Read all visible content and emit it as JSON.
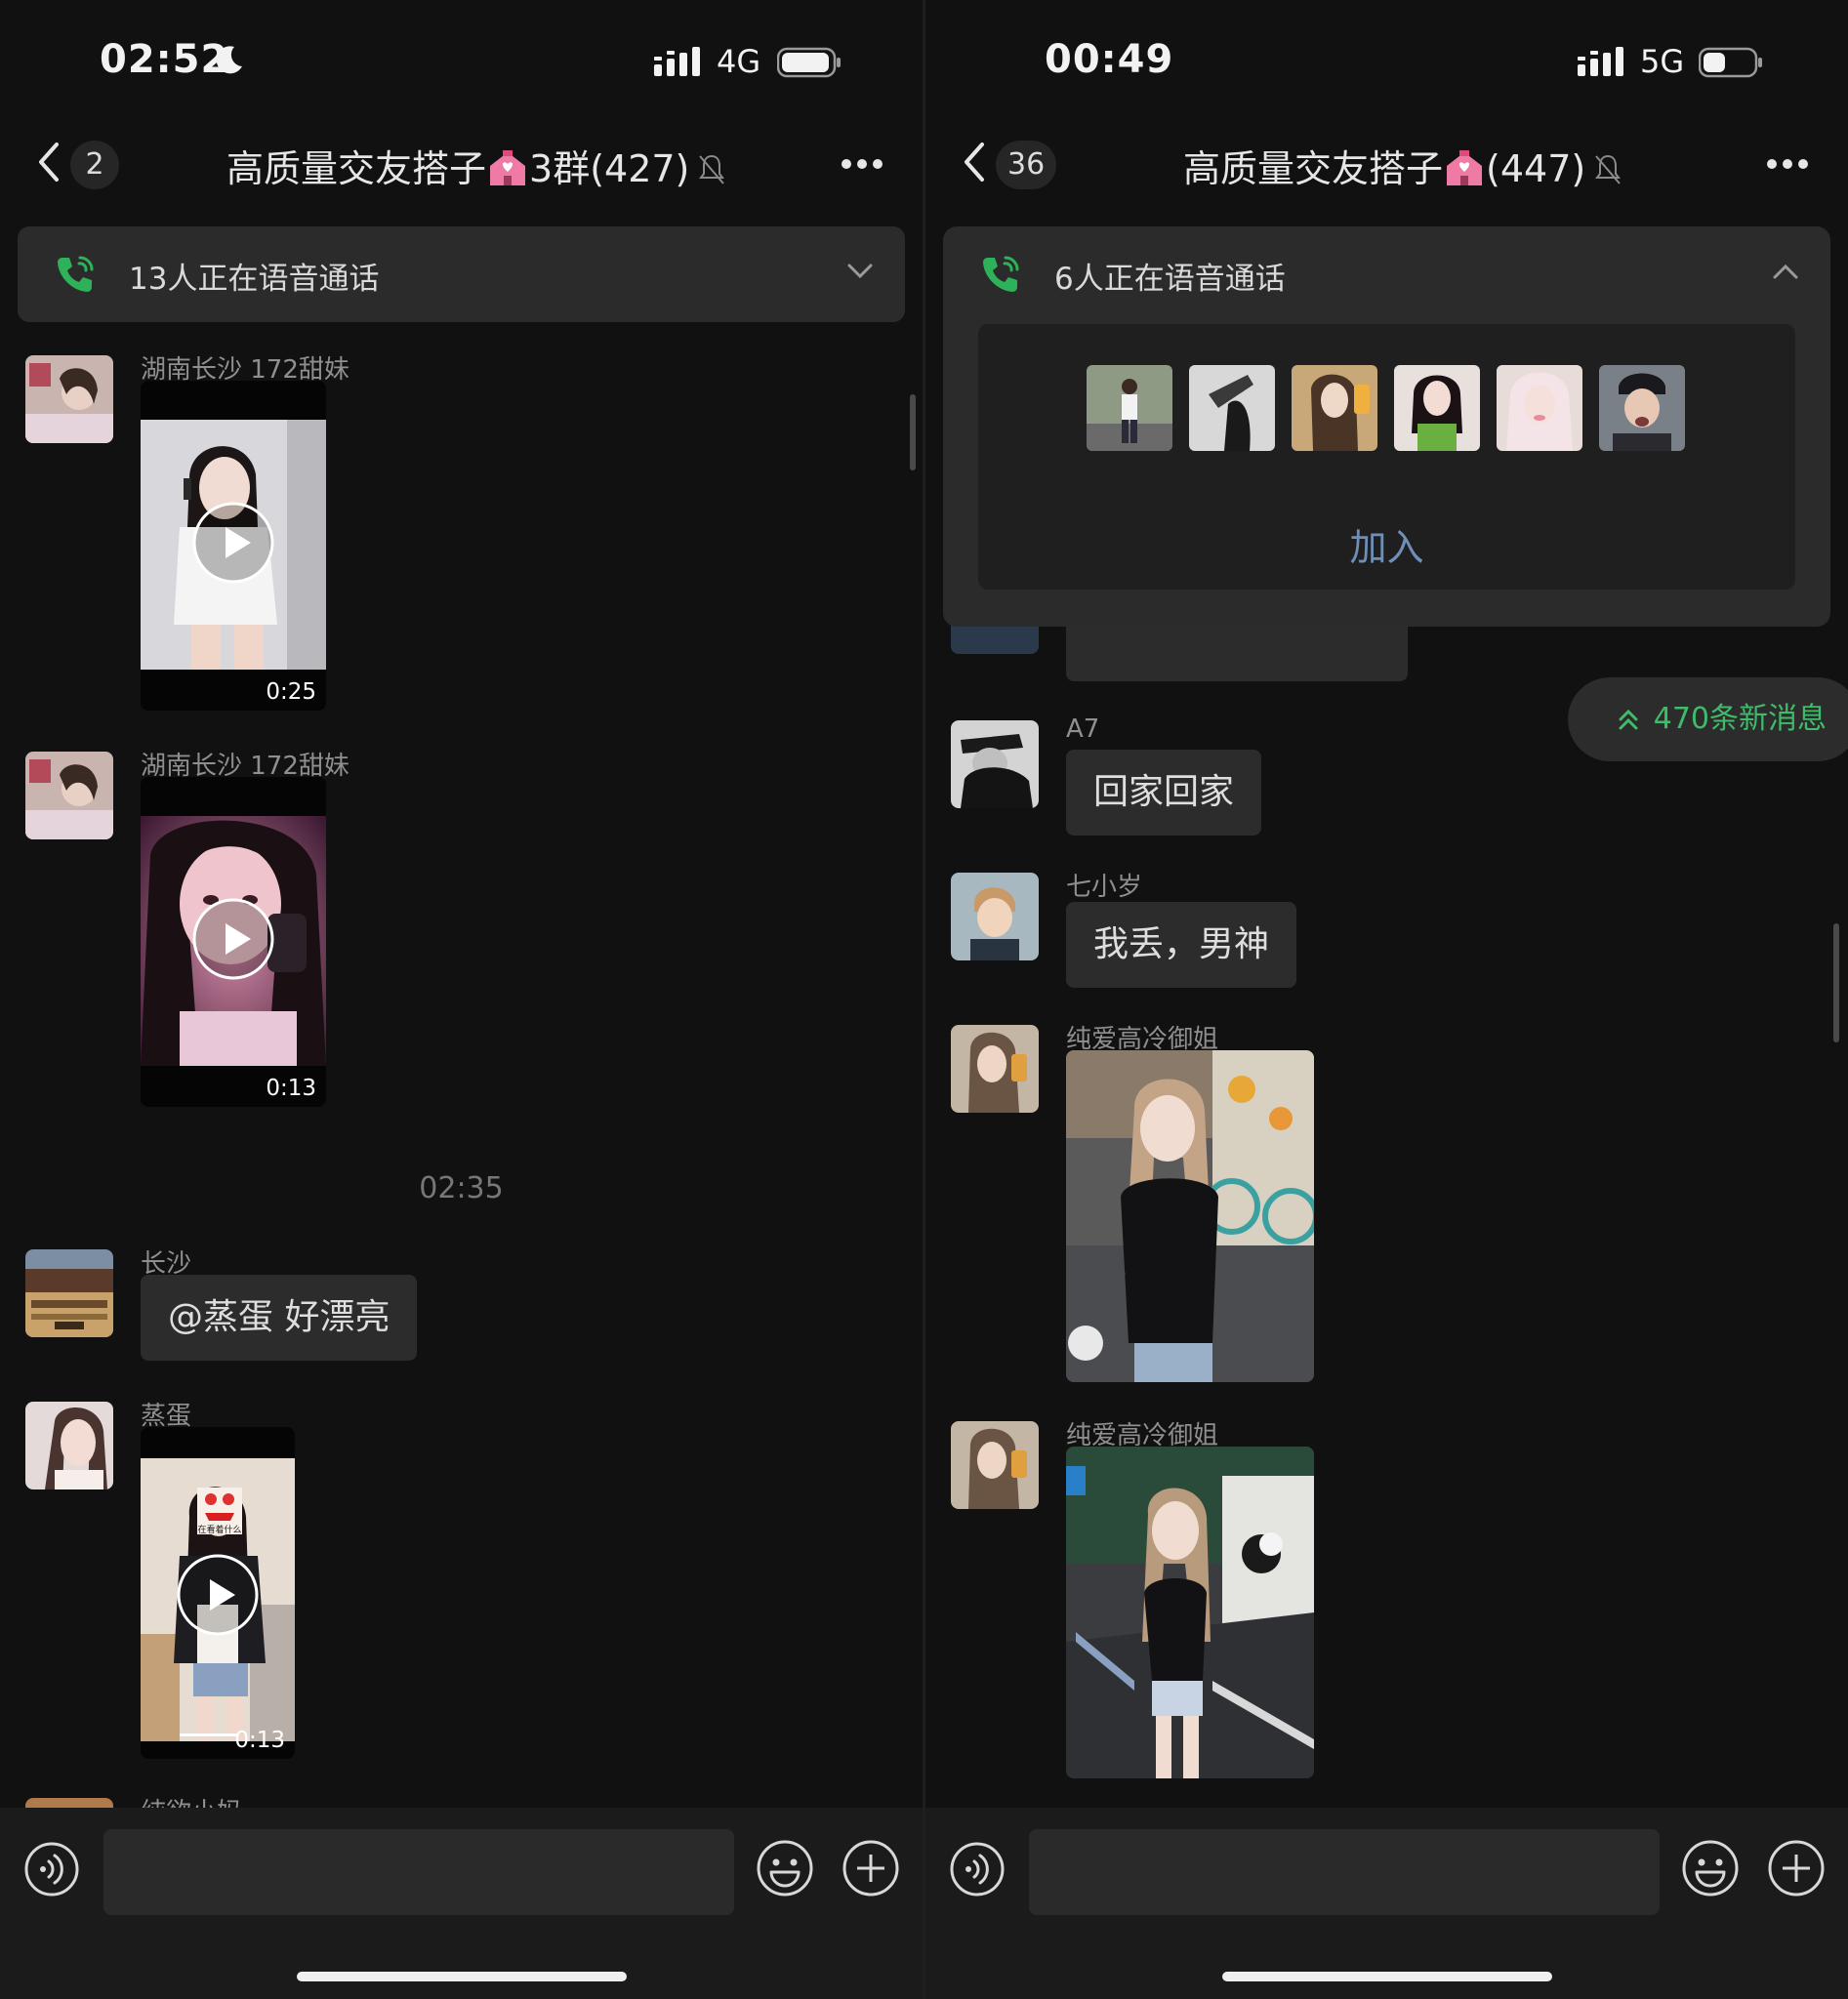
{
  "left": {
    "status": {
      "time": "02:52",
      "network": "4G"
    },
    "nav": {
      "unread_count": "2",
      "title_prefix": "高质量交友搭子",
      "title_suffix": "3群(427)"
    },
    "voice_call": {
      "text": "13人正在语音通话"
    },
    "messages": [
      {
        "sender": "湖南长沙 172甜妹",
        "type": "video",
        "duration": "0:25"
      },
      {
        "sender": "湖南长沙 172甜妹",
        "type": "video",
        "duration": "0:13"
      },
      {
        "type": "time",
        "text": "02:35"
      },
      {
        "sender": "长沙",
        "type": "text",
        "text": "@蒸蛋 好漂亮"
      },
      {
        "sender": "蒸蛋",
        "type": "video",
        "duration": "0:13",
        "sticker_text": "在看着什么"
      },
      {
        "sender": "纯欲小妈",
        "type": "partial"
      }
    ]
  },
  "right": {
    "status": {
      "time": "00:49",
      "network": "5G"
    },
    "nav": {
      "unread_count": "36",
      "title_prefix": "高质量交友搭子",
      "title_suffix": "(447)"
    },
    "voice_call": {
      "text": "6人正在语音通话",
      "join_label": "加入",
      "participant_count": 6
    },
    "new_messages": "470条新消息",
    "messages": [
      {
        "sender": "A7",
        "type": "text",
        "text": "回家回家"
      },
      {
        "sender": "七小岁",
        "type": "text",
        "text": "我丢，男神"
      },
      {
        "sender": "纯爱高冷御姐",
        "type": "image"
      },
      {
        "sender": "纯爱高冷御姐",
        "type": "image"
      }
    ]
  },
  "colors": {
    "background": "#111111",
    "bubble": "#2c2c2c",
    "accent_green": "#3fbb6a",
    "join_blue": "#6f8fb8",
    "input_bar": "#1b1b1b"
  },
  "icons": [
    "moon-icon",
    "signal-icon",
    "battery-icon",
    "back-chevron-icon",
    "mute-icon",
    "more-icon",
    "phone-call-icon",
    "chevron-down-icon",
    "chevron-up-icon",
    "play-icon",
    "double-chevron-up-icon",
    "voice-input-icon",
    "emoji-icon",
    "plus-icon"
  ]
}
